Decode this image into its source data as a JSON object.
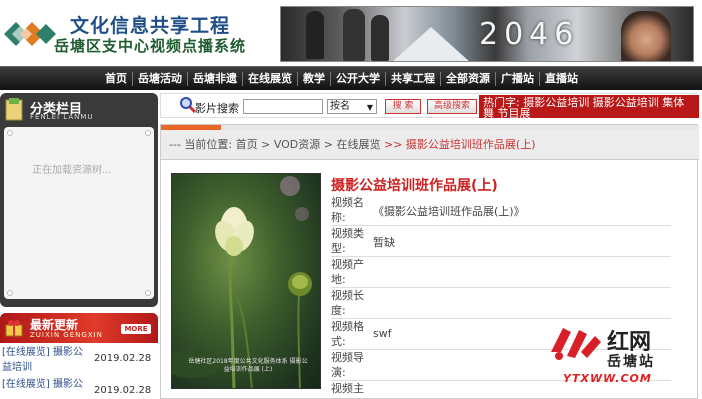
{
  "header": {
    "title_line1": "文化信息共享工程",
    "title_line2": "岳塘区支中心视频点播系统",
    "banner_text": "2046"
  },
  "nav": {
    "items": [
      "首页",
      "岳塘活动",
      "岳塘非遗",
      "在线展览",
      "教学",
      "公开大学",
      "共享工程",
      "全部资源",
      "广播站",
      "直播站"
    ]
  },
  "sidebar": {
    "category_title": "分类栏目",
    "category_subtitle": "FENLEI LANMU",
    "loading_text": "正在加载资源树...",
    "updates_title": "最新更新",
    "updates_subtitle": "ZUIXIN GENGXIN",
    "more_label": "MORE",
    "updates": [
      {
        "title": "[在线展览] 摄影公益培训",
        "date": "2019.02.28"
      },
      {
        "title": "[在线展览] 摄影公",
        "date": "2019.02.28"
      }
    ]
  },
  "search": {
    "label": "影片搜索",
    "input_value": "",
    "select_value": "按名",
    "search_button": "搜 索",
    "advanced_button": "高级搜索",
    "hot_label": "热门字: 摄影公益培训 摄影公益培训 集体舞 节目展",
    "hot_words": [
      "摄影公益培训",
      "摄影公益培训",
      "集体舞",
      "节目展"
    ]
  },
  "breadcrumb": {
    "prefix": "--- 当前位置: ",
    "path": "首页 > VOD资源 > 在线展览 ",
    "current": ">> 摄影公益培训班作品展(上)"
  },
  "detail": {
    "title": "摄影公益培训班作品展(上)",
    "poster_caption": "岳塘社区2018年度公共文化服务体系 摄影公益培训作品展 (上)",
    "fields": [
      {
        "label": "视频名称:",
        "value": "《摄影公益培训班作品展(上)》"
      },
      {
        "label": "视频类型:",
        "value": "暂缺"
      },
      {
        "label": "视频产地:",
        "value": ""
      },
      {
        "label": "视频长度:",
        "value": ""
      },
      {
        "label": "视频格式:",
        "value": "swf"
      },
      {
        "label": "视频导演:",
        "value": ""
      },
      {
        "label": "视频主",
        "value": ""
      }
    ]
  },
  "watermark": {
    "brand": "红网",
    "station": "岳塘站",
    "url": "YTXWW.COM"
  },
  "colors": {
    "nav_bg": "#1a1a1a",
    "accent_red": "#c22222",
    "link_blue": "#2c4d8a"
  }
}
